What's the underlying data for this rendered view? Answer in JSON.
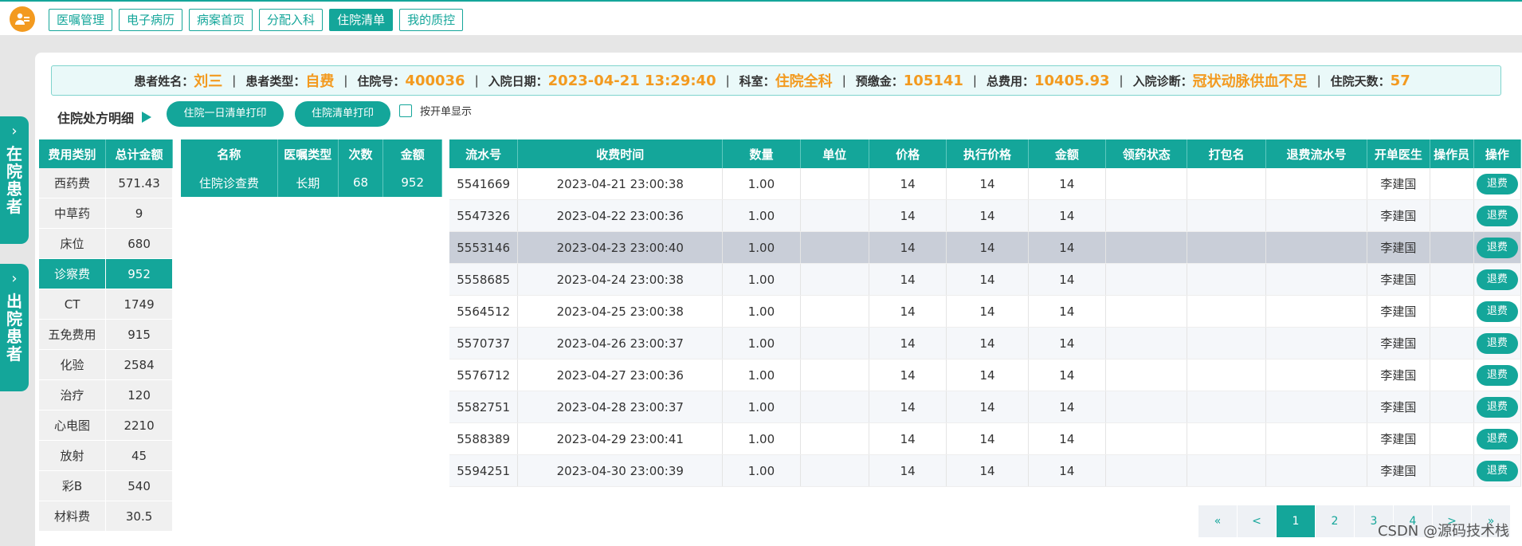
{
  "nav": {
    "tabs": [
      {
        "label": "医嘱管理",
        "active": false
      },
      {
        "label": "电子病历",
        "active": false
      },
      {
        "label": "病案首页",
        "active": false
      },
      {
        "label": "分配入科",
        "active": false
      },
      {
        "label": "住院清单",
        "active": true
      },
      {
        "label": "我的质控",
        "active": false
      }
    ]
  },
  "side": {
    "inpatient": "在院患者",
    "discharged": "出院患者"
  },
  "patient": {
    "name_label": "患者姓名：",
    "name": "刘三",
    "type_label": "患者类型：",
    "type": "自费",
    "adm_no_label": "住院号：",
    "adm_no": "400036",
    "adm_date_label": "入院日期：",
    "adm_date": "2023-04-21 13:29:40",
    "dept_label": "科室：",
    "dept": "住院全科",
    "deposit_label": "预缴金：",
    "deposit": "105141",
    "total_label": "总费用：",
    "total": "10405.93",
    "diag_label": "入院诊断：",
    "diag": "冠状动脉供血不足",
    "days_label": "住院天数：",
    "days": "57",
    "sep": "|"
  },
  "section": {
    "title": "住院处方明细",
    "print_day_label": "住院一日清单打印",
    "print_all_label": "住院清单打印",
    "by_order_label": "按开单显示"
  },
  "categories": {
    "headers": [
      "费用类别",
      "总计金额"
    ],
    "rows": [
      {
        "name": "西药费",
        "amount": "571.43",
        "active": false
      },
      {
        "name": "中草药",
        "amount": "9",
        "active": false
      },
      {
        "name": "床位",
        "amount": "680",
        "active": false
      },
      {
        "name": "诊察费",
        "amount": "952",
        "active": true
      },
      {
        "name": "CT",
        "amount": "1749",
        "active": false
      },
      {
        "name": "五免费用",
        "amount": "915",
        "active": false
      },
      {
        "name": "化验",
        "amount": "2584",
        "active": false
      },
      {
        "name": "治疗",
        "amount": "120",
        "active": false
      },
      {
        "name": "心电图",
        "amount": "2210",
        "active": false
      },
      {
        "name": "放射",
        "amount": "45",
        "active": false
      },
      {
        "name": "彩B",
        "amount": "540",
        "active": false
      },
      {
        "name": "材料费",
        "amount": "30.5",
        "active": false
      }
    ]
  },
  "items": {
    "headers": [
      "名称",
      "医嘱类型",
      "次数",
      "金额"
    ],
    "rows": [
      {
        "name": "住院诊查费",
        "type": "长期",
        "count": "68",
        "amount": "952"
      }
    ]
  },
  "details": {
    "headers": [
      "流水号",
      "收费时间",
      "数量",
      "单位",
      "价格",
      "执行价格",
      "金额",
      "领药状态",
      "打包名",
      "退费流水号",
      "开单医生",
      "操作员",
      "操作"
    ],
    "refund_label": "退费",
    "rows": [
      {
        "serial": "5541669",
        "time": "2023-04-21 23:00:38",
        "qty": "1.00",
        "unit": "",
        "price": "14",
        "exec_price": "14",
        "amount": "14",
        "status": "",
        "pkg": "",
        "refund_no": "",
        "doctor": "李建国",
        "operator": "",
        "highlight": false
      },
      {
        "serial": "5547326",
        "time": "2023-04-22 23:00:36",
        "qty": "1.00",
        "unit": "",
        "price": "14",
        "exec_price": "14",
        "amount": "14",
        "status": "",
        "pkg": "",
        "refund_no": "",
        "doctor": "李建国",
        "operator": "",
        "highlight": false
      },
      {
        "serial": "5553146",
        "time": "2023-04-23 23:00:40",
        "qty": "1.00",
        "unit": "",
        "price": "14",
        "exec_price": "14",
        "amount": "14",
        "status": "",
        "pkg": "",
        "refund_no": "",
        "doctor": "李建国",
        "operator": "",
        "highlight": true
      },
      {
        "serial": "5558685",
        "time": "2023-04-24 23:00:38",
        "qty": "1.00",
        "unit": "",
        "price": "14",
        "exec_price": "14",
        "amount": "14",
        "status": "",
        "pkg": "",
        "refund_no": "",
        "doctor": "李建国",
        "operator": "",
        "highlight": false
      },
      {
        "serial": "5564512",
        "time": "2023-04-25 23:00:38",
        "qty": "1.00",
        "unit": "",
        "price": "14",
        "exec_price": "14",
        "amount": "14",
        "status": "",
        "pkg": "",
        "refund_no": "",
        "doctor": "李建国",
        "operator": "",
        "highlight": false
      },
      {
        "serial": "5570737",
        "time": "2023-04-26 23:00:37",
        "qty": "1.00",
        "unit": "",
        "price": "14",
        "exec_price": "14",
        "amount": "14",
        "status": "",
        "pkg": "",
        "refund_no": "",
        "doctor": "李建国",
        "operator": "",
        "highlight": false
      },
      {
        "serial": "5576712",
        "time": "2023-04-27 23:00:36",
        "qty": "1.00",
        "unit": "",
        "price": "14",
        "exec_price": "14",
        "amount": "14",
        "status": "",
        "pkg": "",
        "refund_no": "",
        "doctor": "李建国",
        "operator": "",
        "highlight": false
      },
      {
        "serial": "5582751",
        "time": "2023-04-28 23:00:37",
        "qty": "1.00",
        "unit": "",
        "price": "14",
        "exec_price": "14",
        "amount": "14",
        "status": "",
        "pkg": "",
        "refund_no": "",
        "doctor": "李建国",
        "operator": "",
        "highlight": false
      },
      {
        "serial": "5588389",
        "time": "2023-04-29 23:00:41",
        "qty": "1.00",
        "unit": "",
        "price": "14",
        "exec_price": "14",
        "amount": "14",
        "status": "",
        "pkg": "",
        "refund_no": "",
        "doctor": "李建国",
        "operator": "",
        "highlight": false
      },
      {
        "serial": "5594251",
        "time": "2023-04-30 23:00:39",
        "qty": "1.00",
        "unit": "",
        "price": "14",
        "exec_price": "14",
        "amount": "14",
        "status": "",
        "pkg": "",
        "refund_no": "",
        "doctor": "李建国",
        "operator": "",
        "highlight": false
      }
    ]
  },
  "pager": {
    "items": [
      {
        "label": "«",
        "active": false
      },
      {
        "label": "<",
        "active": false
      },
      {
        "label": "1",
        "active": true
      },
      {
        "label": "2",
        "active": false
      },
      {
        "label": "3",
        "active": false
      },
      {
        "label": "4",
        "active": false
      },
      {
        "label": ">",
        "active": false
      },
      {
        "label": "»",
        "active": false
      }
    ]
  },
  "watermark": "CSDN @源码技术栈",
  "colors": {
    "accent": "#14a69a",
    "highlight_text": "#f39a1f",
    "selected_row": "#c9ced8"
  }
}
